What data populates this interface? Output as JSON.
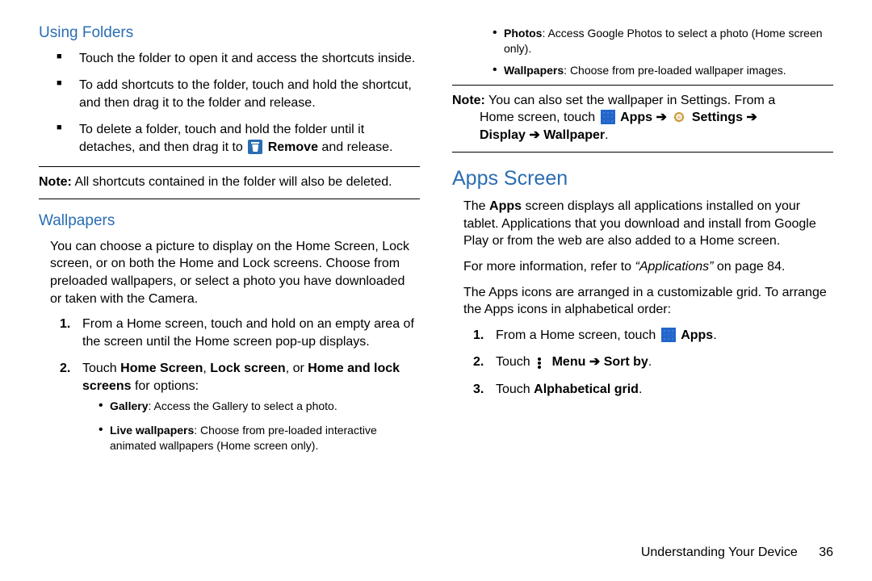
{
  "left": {
    "usingFolders": {
      "heading": "Using Folders",
      "b1": "Touch the folder to open it and access the shortcuts inside.",
      "b2": "To add shortcuts to the folder, touch and hold the shortcut, and then drag it to the folder and release.",
      "b3a": "To delete a folder, touch and hold the folder until it detaches, and then drag it to ",
      "b3_remove": "Remove",
      "b3b": " and release."
    },
    "noteFolders_pre": "Note:",
    "noteFolders_body": " All shortcuts contained in the folder will also be deleted.",
    "wallpapers": {
      "heading": "Wallpapers",
      "intro": "You can choose a picture to display on the Home Screen, Lock screen, or on both the Home and Lock screens. Choose from preloaded wallpapers, or select a photo you have downloaded or taken with the Camera.",
      "s1": "From a Home screen, touch and hold on an empty area of the screen until the Home screen pop-up displays.",
      "s2a": "Touch ",
      "s2_home": "Home Screen",
      "s2_comma1": ", ",
      "s2_lock": "Lock screen",
      "s2_or": ", or ",
      "s2_hal": "Home and lock screens",
      "s2b": " for options:",
      "opt1_key": "Gallery",
      "opt1_body": ": Access the Gallery to select a photo.",
      "opt2_key": "Live wallpapers",
      "opt2_body": ": Choose from pre-loaded interactive animated wallpapers (Home screen only)."
    }
  },
  "right": {
    "wp_opts": {
      "opt3_key": "Photos",
      "opt3_body": ": Access Google Photos to select a photo (Home screen only).",
      "opt4_key": "Wallpapers",
      "opt4_body": ": Choose from pre-loaded wallpaper images."
    },
    "noteWp_pre": "Note:",
    "noteWp_l1": " You can also set the wallpaper in Settings. From a",
    "noteWp_l2a": "Home screen, touch ",
    "noteWp_apps": "Apps",
    "noteWp_arrow": " ➔ ",
    "noteWp_settings": "Settings",
    "noteWp_l3a": "Display",
    "noteWp_l3b": "Wallpaper",
    "noteWp_dot": ".",
    "apps": {
      "heading": "Apps Screen",
      "p1a": "The ",
      "p1_key": "Apps",
      "p1b": " screen displays all applications installed on your tablet. Applications that you download and install from Google Play or from the web are also added to a Home screen.",
      "p2a": "For more information, refer to ",
      "p2_ref": "“Applications”",
      "p2b": " on page 84.",
      "p3": "The Apps icons are arranged in a customizable grid. To arrange the Apps icons in alphabetical order:",
      "s1a": "From a Home screen, touch ",
      "s1_apps": "Apps",
      "s1b": ".",
      "s2a": "Touch ",
      "s2_menu": "Menu",
      "s2_arrow": " ➔ ",
      "s2_sort": "Sort by",
      "s2b": ".",
      "s3a": "Touch ",
      "s3_key": "Alphabetical grid",
      "s3b": "."
    }
  },
  "footer": {
    "section": "Understanding Your Device",
    "page": "36"
  }
}
